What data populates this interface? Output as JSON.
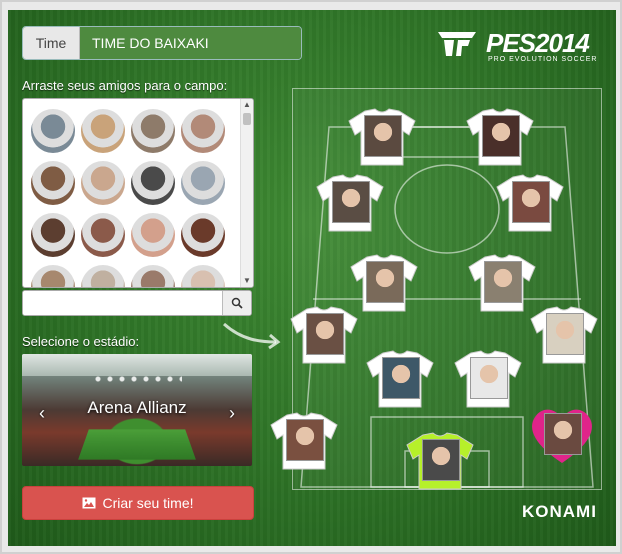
{
  "time": {
    "label": "Time",
    "value": "TIME DO BAIXAKI"
  },
  "friends": {
    "label": "Arraste seus amigos para o campo:",
    "avatars": [
      {
        "color": "#7a8a96"
      },
      {
        "color": "#c9a37a"
      },
      {
        "color": "#8e7b6a"
      },
      {
        "color": "#b28a78"
      },
      {
        "color": "#7f5c44"
      },
      {
        "color": "#caa78e"
      },
      {
        "color": "#4a4a4a"
      },
      {
        "color": "#9aa6b2"
      },
      {
        "color": "#5c3e30"
      },
      {
        "color": "#8b5a4a"
      },
      {
        "color": "#d3a08c"
      },
      {
        "color": "#6a3a2a"
      },
      {
        "color": "#a7886e"
      },
      {
        "color": "#c0b0a0"
      },
      {
        "color": "#9a7a6a"
      },
      {
        "color": "#d8c0b0"
      }
    ]
  },
  "search": {
    "placeholder": ""
  },
  "stadium": {
    "label": "Selecione o estádio:",
    "name": "Arena Allianz"
  },
  "create_button": {
    "label": "Criar seu time!"
  },
  "logo": {
    "title": "PES2014",
    "subtitle": "PRO EVOLUTION SOCCER"
  },
  "brand": {
    "konami": "KONAMI"
  },
  "players": [
    {
      "id": "p1",
      "shirt": "#ffffff",
      "photo": "#5b4a40"
    },
    {
      "id": "p2",
      "shirt": "#ffffff",
      "photo": "#4a2f2a"
    },
    {
      "id": "p3",
      "shirt": "#ffffff",
      "photo": "#5a4d44"
    },
    {
      "id": "p4",
      "shirt": "#ffffff",
      "photo": "#7a4a40"
    },
    {
      "id": "p5",
      "shirt": "#ffffff",
      "photo": "#7a6a5a"
    },
    {
      "id": "p6",
      "shirt": "#ffffff",
      "photo": "#8a8070"
    },
    {
      "id": "p7",
      "shirt": "#ffffff",
      "photo": "#6a5044"
    },
    {
      "id": "p8",
      "shirt": "#ffffff",
      "photo": "#d8d0c0"
    },
    {
      "id": "p9",
      "shirt": "#ffffff",
      "photo": "#3e5868"
    },
    {
      "id": "p10",
      "shirt": "#ffffff",
      "photo": "#e8e8e8"
    },
    {
      "id": "p11",
      "shirt": "#ffffff",
      "photo": "#7a5040"
    },
    {
      "id": "gk",
      "shirt": "#b6f02a",
      "photo": "#4a4a4a"
    },
    {
      "id": "fav",
      "shirt": "heart",
      "photo": "#6a4a40"
    }
  ],
  "colors": {
    "create": "#d9534f",
    "goalkeeper": "#b6f02a",
    "heart": "#e0248a"
  }
}
